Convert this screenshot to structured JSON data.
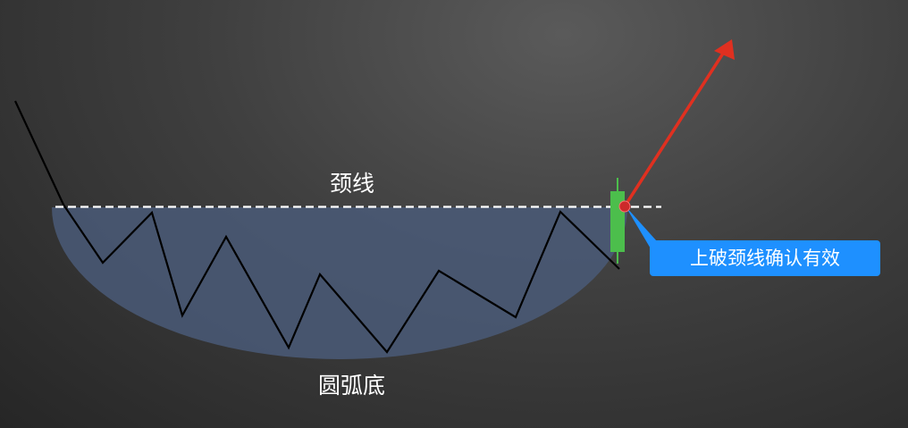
{
  "labels": {
    "neckline": "颈线",
    "rounding_bottom": "圆弧底",
    "breakout_callout": "上破颈线确认有效"
  },
  "colors": {
    "background": "#3b3b3b",
    "bowl_fill": "#4a5a78",
    "price_line": "#000000",
    "neckline": "#ffffff",
    "candle_body": "#4cbe4c",
    "breakout_arrow": "#e03020",
    "breakout_point": "#cc2a2a",
    "callout": "#1e90ff"
  },
  "icons": {
    "breakout_arrow": "arrow-up-right-icon",
    "breakout_point": "dot-icon"
  }
}
